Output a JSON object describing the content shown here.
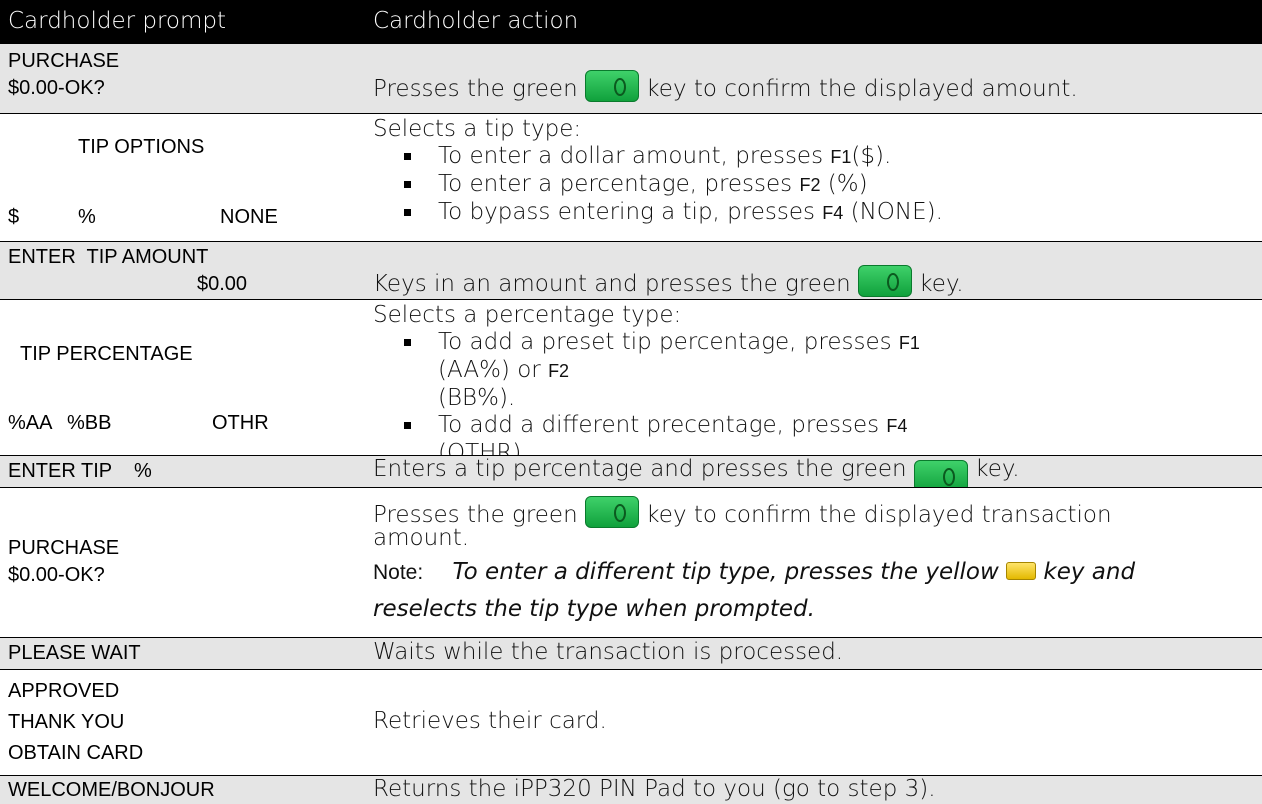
{
  "header": {
    "prompt_col": "Cardholder prompt",
    "action_col": "Cardholder action"
  },
  "rows": [
    {
      "prompt_lines": [
        "PURCHASE",
        "$0.00-OK?"
      ],
      "action_before": "Presses the green ",
      "action_after": " key to confirm the displayed amount."
    },
    {
      "prompt_title": "TIP OPTIONS",
      "prompt_opts": [
        "$",
        "%",
        "NONE"
      ],
      "action_intro": "Selects a tip type:",
      "bullets": [
        {
          "a": "To enter a dollar amount, presses ",
          "k": "F1",
          "b": "($)."
        },
        {
          "a": "To enter a percentage, presses ",
          "k": "F2",
          "b": " (%)"
        },
        {
          "a": "To bypass entering a tip, presses ",
          "k": "F4",
          "b": " (NONE)."
        }
      ]
    },
    {
      "prompt_line1": "ENTER  TIP AMOUNT",
      "prompt_line2": "$0.00",
      "action_before": "Keys in an amount and presses the green ",
      "action_after": " key."
    },
    {
      "prompt_title": "TIP PERCENTAGE",
      "prompt_opts": [
        "%AA",
        "%BB",
        "OTHR"
      ],
      "action_intro": "Selects a percentage type:",
      "b1_a": "To add a preset tip percentage, presses ",
      "b1_k1": "F1",
      "b1_m": " (AA%) or ",
      "b1_k2": "F2",
      "b1_c": "(BB%).",
      "b2_a": "To add a different precentage, presses ",
      "b2_k": "F4",
      "b2_b": " (OTHR)."
    },
    {
      "prompt_line1": "ENTER TIP    %",
      "action_before": "Enters a tip percentage and presses the green ",
      "action_after": " key."
    },
    {
      "prompt_lines": [
        "PURCHASE",
        "$0.00-OK?"
      ],
      "action_before": "Presses the green ",
      "action_after": " key to confirm the displayed transaction",
      "action_line2": "amount.",
      "note_label": "Note:",
      "note_before": "To enter a different tip type, presses the yellow ",
      "note_after": " key and",
      "note_line2": "reselects the tip type when prompted."
    },
    {
      "prompt_line1": "PLEASE WAIT",
      "action": "Waits while the transaction is processed."
    },
    {
      "prompt_lines": [
        "APPROVED",
        "THANK YOU",
        "OBTAIN CARD"
      ],
      "action": "Retrieves their card."
    },
    {
      "prompt_line1": "WELCOME/BONJOUR",
      "action": "Returns the iPP320 PIN Pad to you (go to step 3)."
    }
  ],
  "icons": {
    "green_key": "green-confirm-key-icon",
    "yellow_key": "yellow-correction-key-icon"
  },
  "colors": {
    "header_bg": "#000000",
    "shade": "#e5e5e5",
    "green_key": "#22b14c",
    "yellow_key": "#f2cb00"
  }
}
